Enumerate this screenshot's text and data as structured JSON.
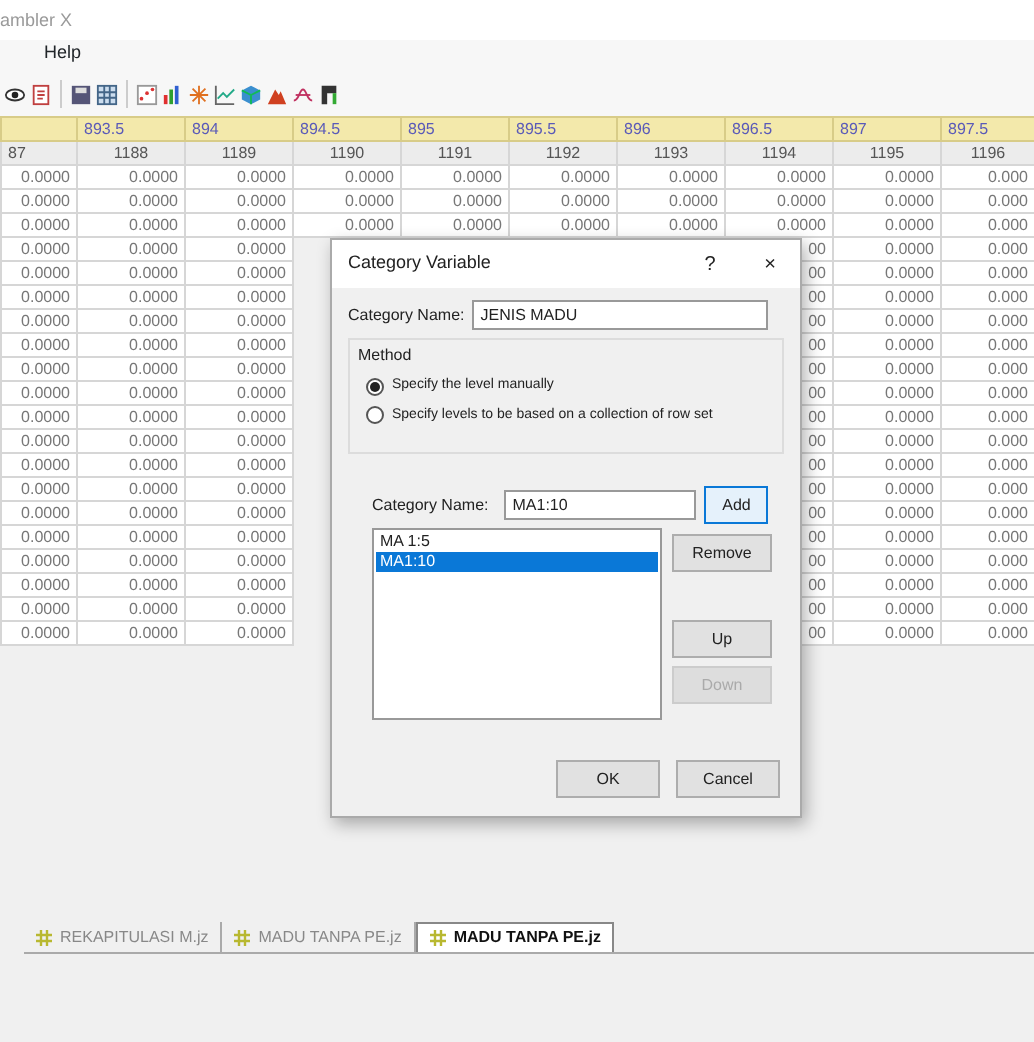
{
  "window": {
    "title": "ambler X"
  },
  "menu": [
    "Help"
  ],
  "table": {
    "columns": [
      {
        "number": "87"
      },
      {
        "label": "893.5",
        "number": "1188"
      },
      {
        "label": "894",
        "number": "1189"
      },
      {
        "label": "894.5",
        "number": "1190"
      },
      {
        "label": "895",
        "number": "1191"
      },
      {
        "label": "895.5",
        "number": "1192"
      },
      {
        "label": "896",
        "number": "1193"
      },
      {
        "label": "896.5",
        "number": "1194"
      },
      {
        "label": "897",
        "number": "1195"
      },
      {
        "label": "897.5",
        "number": "1196"
      }
    ],
    "rows": [
      {
        "covered": false,
        "cells": [
          "0.0000",
          "0.0000",
          "0.0000",
          "0.0000",
          "0.0000",
          "0.0000",
          "0.0000",
          "0.0000",
          "0.0000",
          "0.000"
        ]
      },
      {
        "covered": false,
        "cells": [
          "0.0000",
          "0.0000",
          "0.0000",
          "0.0000",
          "0.0000",
          "0.0000",
          "0.0000",
          "0.0000",
          "0.0000",
          "0.000"
        ]
      },
      {
        "covered": false,
        "cells": [
          "0.0000",
          "0.0000",
          "0.0000",
          "0.0000",
          "0.0000",
          "0.0000",
          "0.0000",
          "0.0000",
          "0.0000",
          "0.000"
        ]
      },
      {
        "covered": true,
        "cells": [
          "0.0000",
          "0.0000",
          "0.0000",
          "00",
          "0.0000",
          "0.000"
        ]
      },
      {
        "covered": true,
        "cells": [
          "0.0000",
          "0.0000",
          "0.0000",
          "00",
          "0.0000",
          "0.000"
        ]
      },
      {
        "covered": true,
        "cells": [
          "0.0000",
          "0.0000",
          "0.0000",
          "00",
          "0.0000",
          "0.000"
        ]
      },
      {
        "covered": true,
        "cells": [
          "0.0000",
          "0.0000",
          "0.0000",
          "00",
          "0.0000",
          "0.000"
        ]
      },
      {
        "covered": true,
        "cells": [
          "0.0000",
          "0.0000",
          "0.0000",
          "00",
          "0.0000",
          "0.000"
        ]
      },
      {
        "covered": true,
        "cells": [
          "0.0000",
          "0.0000",
          "0.0000",
          "00",
          "0.0000",
          "0.000"
        ]
      },
      {
        "covered": true,
        "cells": [
          "0.0000",
          "0.0000",
          "0.0000",
          "00",
          "0.0000",
          "0.000"
        ]
      },
      {
        "covered": true,
        "cells": [
          "0.0000",
          "0.0000",
          "0.0000",
          "00",
          "0.0000",
          "0.000"
        ]
      },
      {
        "covered": true,
        "cells": [
          "0.0000",
          "0.0000",
          "0.0000",
          "00",
          "0.0000",
          "0.000"
        ]
      },
      {
        "covered": true,
        "cells": [
          "0.0000",
          "0.0000",
          "0.0000",
          "00",
          "0.0000",
          "0.000"
        ]
      },
      {
        "covered": true,
        "cells": [
          "0.0000",
          "0.0000",
          "0.0000",
          "00",
          "0.0000",
          "0.000"
        ]
      },
      {
        "covered": true,
        "cells": [
          "0.0000",
          "0.0000",
          "0.0000",
          "00",
          "0.0000",
          "0.000"
        ]
      },
      {
        "covered": true,
        "cells": [
          "0.0000",
          "0.0000",
          "0.0000",
          "00",
          "0.0000",
          "0.000"
        ]
      },
      {
        "covered": true,
        "cells": [
          "0.0000",
          "0.0000",
          "0.0000",
          "00",
          "0.0000",
          "0.000"
        ]
      },
      {
        "covered": true,
        "cells": [
          "0.0000",
          "0.0000",
          "0.0000",
          "00",
          "0.0000",
          "0.000"
        ]
      },
      {
        "covered": true,
        "cells": [
          "0.0000",
          "0.0000",
          "0.0000",
          "00",
          "0.0000",
          "0.000"
        ]
      },
      {
        "covered": true,
        "cells": [
          "0.0000",
          "0.0000",
          "0.0000",
          "00",
          "0.0000",
          "0.000"
        ]
      }
    ]
  },
  "dialog": {
    "title": "Category Variable",
    "help": "?",
    "close": "×",
    "name_label": "Category Name:",
    "name_value": "JENIS MADU",
    "method": {
      "label": "Method",
      "options": [
        {
          "label": "Specify the level manually",
          "selected": true
        },
        {
          "label": "Specify levels to be based on a collection of row set",
          "selected": false
        }
      ]
    },
    "level_label": "Category Name:",
    "level_value": "MA1:10",
    "levels": [
      {
        "label": "MA 1:5",
        "selected": false
      },
      {
        "label": "MA1:10",
        "selected": true
      }
    ],
    "side_buttons": [
      {
        "label": "Add",
        "disabled": false,
        "focused": true
      },
      {
        "label": "Remove",
        "disabled": false,
        "focused": false
      },
      {
        "label": "Up",
        "disabled": false,
        "focused": false
      },
      {
        "label": "Down",
        "disabled": true,
        "focused": false
      }
    ],
    "footer_buttons": [
      "OK",
      "Cancel"
    ]
  },
  "tabs": [
    {
      "label": "REKAPITULASI M.jz",
      "selected": false
    },
    {
      "label": "MADU TANPA PE.jz",
      "selected": false
    },
    {
      "label": "MADU TANPA PE.jz",
      "selected": true
    }
  ]
}
